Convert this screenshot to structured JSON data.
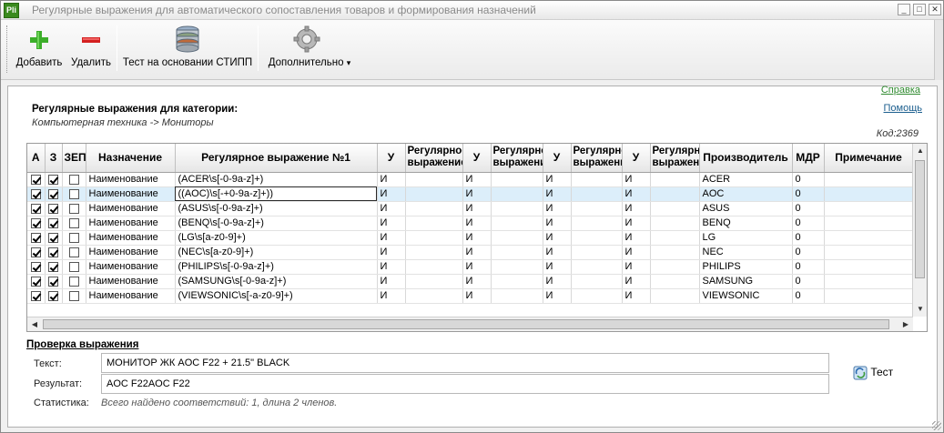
{
  "window": {
    "app_icon_text": "Pli",
    "title": "Регулярные выражения для автоматического сопоставления товаров и формирования назначений",
    "min_glyph": "_",
    "max_glyph": "□",
    "close_glyph": "✕"
  },
  "toolbar": {
    "add_label": "Добавить",
    "delete_label": "Удалить",
    "test_label": "Тест на основании СТИПП",
    "more_label": "Дополнительно",
    "more_arrow": "▾"
  },
  "header": {
    "help_label": "Справка",
    "title": "Регулярные выражения для категории:",
    "category_path": "Компьютерная техника -> Мониторы",
    "help2_label": "Помощь",
    "code": "Код:2369"
  },
  "grid": {
    "columns": {
      "a": "А",
      "z": "З",
      "zep": "ЗЕП",
      "purpose": "Назначение",
      "regex1": "Регулярное выражение №1",
      "u1": "У",
      "regex2": "Регулярное выражение",
      "u2": "У",
      "regex3": "Регулярное выражение",
      "u3": "У",
      "regex4": "Регулярное выражение",
      "u4": "У",
      "regex5": "Регулярное выражение",
      "manufacturer": "Производитель",
      "mdr": "МДР",
      "note": "Примечание"
    },
    "rows": [
      {
        "a": true,
        "z": true,
        "zep": false,
        "purpose": "Наименование",
        "regex1": "(ACER\\s[-0-9a-z]+)",
        "u1": "И",
        "u2": "И",
        "u3": "И",
        "u4": "И",
        "manufacturer": "ACER",
        "mdr": "0",
        "note": ""
      },
      {
        "a": true,
        "z": true,
        "zep": false,
        "purpose": "Наименование",
        "regex1": "((AOC)\\s[-+0-9a-z]+))",
        "u1": "И",
        "u2": "И",
        "u3": "И",
        "u4": "И",
        "manufacturer": "AOC",
        "mdr": "0",
        "note": ""
      },
      {
        "a": true,
        "z": true,
        "zep": false,
        "purpose": "Наименование",
        "regex1": "(ASUS\\s[-0-9a-z]+)",
        "u1": "И",
        "u2": "И",
        "u3": "И",
        "u4": "И",
        "manufacturer": "ASUS",
        "mdr": "0",
        "note": ""
      },
      {
        "a": true,
        "z": true,
        "zep": false,
        "purpose": "Наименование",
        "regex1": "(BENQ\\s[-0-9a-z]+)",
        "u1": "И",
        "u2": "И",
        "u3": "И",
        "u4": "И",
        "manufacturer": "BENQ",
        "mdr": "0",
        "note": ""
      },
      {
        "a": true,
        "z": true,
        "zep": false,
        "purpose": "Наименование",
        "regex1": "(LG\\s[a-z0-9]+)",
        "u1": "И",
        "u2": "И",
        "u3": "И",
        "u4": "И",
        "manufacturer": "LG",
        "mdr": "0",
        "note": ""
      },
      {
        "a": true,
        "z": true,
        "zep": false,
        "purpose": "Наименование",
        "regex1": "(NEC\\s[a-z0-9]+)",
        "u1": "И",
        "u2": "И",
        "u3": "И",
        "u4": "И",
        "manufacturer": "NEC",
        "mdr": "0",
        "note": ""
      },
      {
        "a": true,
        "z": true,
        "zep": false,
        "purpose": "Наименование",
        "regex1": "(PHILIPS\\s[-0-9a-z]+)",
        "u1": "И",
        "u2": "И",
        "u3": "И",
        "u4": "И",
        "manufacturer": "PHILIPS",
        "mdr": "0",
        "note": ""
      },
      {
        "a": true,
        "z": true,
        "zep": false,
        "purpose": "Наименование",
        "regex1": "(SAMSUNG\\s[-0-9a-z]+)",
        "u1": "И",
        "u2": "И",
        "u3": "И",
        "u4": "И",
        "manufacturer": "SAMSUNG",
        "mdr": "0",
        "note": ""
      },
      {
        "a": true,
        "z": true,
        "zep": false,
        "purpose": "Наименование",
        "regex1": "(VIEWSONIC\\s[-a-z0-9]+)",
        "u1": "И",
        "u2": "И",
        "u3": "И",
        "u4": "И",
        "manufacturer": "VIEWSONIC",
        "mdr": "0",
        "note": ""
      }
    ],
    "selected_row": 1,
    "scroll_up_glyph": "▲",
    "scroll_down_glyph": "▼",
    "scroll_left_glyph": "◀",
    "scroll_right_glyph": "▶"
  },
  "check": {
    "section_title": "Проверка выражения",
    "text_label": "Текст:",
    "text_value": "МОНИТОР ЖК AOC F22 + 21.5\" BLACK",
    "result_label": "Результат:",
    "result_value": "AOC F22AOC F22",
    "stats_label": "Статистика:",
    "stats_value": "Всего найдено соответствий: 1, длина 2 членов.",
    "test_button_label": "Тест"
  },
  "colors": {
    "selected_row": "#dceefa",
    "link": "#1b5e8e",
    "help_link": "#2f8a2f",
    "add_icon": "#3cae2a",
    "delete_icon": "#d42020"
  }
}
